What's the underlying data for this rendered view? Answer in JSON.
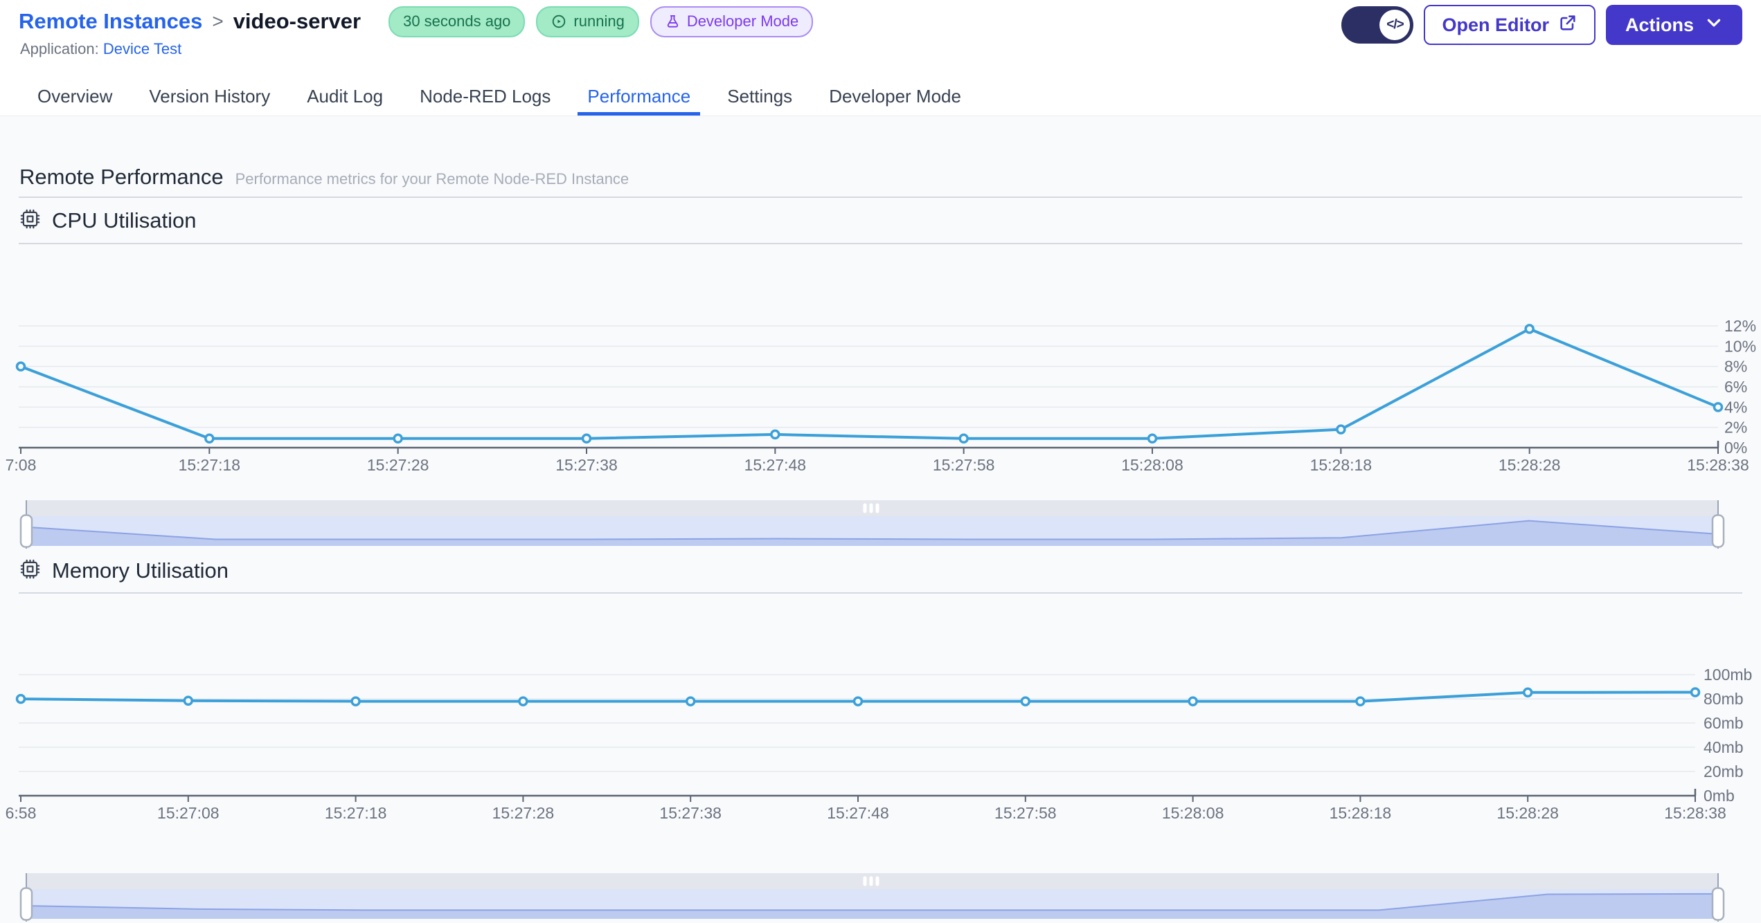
{
  "header": {
    "breadcrumb": {
      "parent": "Remote Instances",
      "separator": ">",
      "current": "video-server"
    },
    "badges": [
      {
        "label": "30 seconds ago",
        "style": "green"
      },
      {
        "label": "running",
        "style": "green",
        "icon": "play-circle-icon"
      },
      {
        "label": "Developer Mode",
        "style": "purple",
        "icon": "flask-icon"
      }
    ],
    "application_label": "Application:",
    "application_name": "Device Test",
    "developer_toggle_icon": "code-icon",
    "open_editor_label": "Open Editor",
    "actions_label": "Actions"
  },
  "tabs": [
    {
      "label": "Overview",
      "active": false
    },
    {
      "label": "Version History",
      "active": false
    },
    {
      "label": "Audit Log",
      "active": false
    },
    {
      "label": "Node-RED Logs",
      "active": false
    },
    {
      "label": "Performance",
      "active": true
    },
    {
      "label": "Settings",
      "active": false
    },
    {
      "label": "Developer Mode",
      "active": false
    }
  ],
  "page": {
    "title": "Remote Performance",
    "subtitle": "Performance metrics for your Remote Node-RED Instance"
  },
  "sections": [
    {
      "title": "CPU Utilisation",
      "icon": "cpu-chip-icon"
    },
    {
      "title": "Memory Utilisation",
      "icon": "cpu-chip-icon"
    }
  ],
  "colors": {
    "accent_indigo": "#4338CA",
    "toggle_navy": "#2B2F63",
    "link_blue": "#2563EB",
    "active_tab_blue": "#2563EB",
    "line_blue": "#3BA0D9",
    "grid": "#E4E9F0",
    "axis": "#5B6472",
    "tick_text": "#6B7280",
    "brush_strip": "#E4E6EE",
    "brush_band": "#DBE4F8",
    "brush_area_fill": "rgba(140,162,228,0.38)",
    "brush_area_line": "#8CA2E4",
    "handle_border": "#A8B0BF",
    "badge_green_bg": "#A3EAC7",
    "badge_green_border": "#7ADDB1",
    "badge_green_text": "#17724D",
    "badge_purple_bg": "#EFECFE",
    "badge_purple_border": "#A98BF5",
    "badge_purple_text": "#7C3AED"
  },
  "chart_data": [
    {
      "type": "line",
      "title": "CPU Utilisation",
      "x_ticks": [
        "7:08",
        "15:27:18",
        "15:27:28",
        "15:27:38",
        "15:27:48",
        "15:27:58",
        "15:28:08",
        "15:28:18",
        "15:28:28",
        "15:28:38"
      ],
      "series": [
        {
          "name": "cpu",
          "values": [
            8,
            0.9,
            0.9,
            0.9,
            1.3,
            0.9,
            0.9,
            1.8,
            11.7,
            4
          ]
        }
      ],
      "y_ticks": [
        "0%",
        "2%",
        "4%",
        "6%",
        "8%",
        "10%",
        "12%"
      ],
      "y_tick_values": [
        0,
        2,
        4,
        6,
        8,
        10,
        12
      ],
      "ylim": [
        0,
        12.8
      ],
      "xlabel": "",
      "ylabel": "",
      "grid": true,
      "legend": false
    },
    {
      "type": "line",
      "title": "Memory Utilisation",
      "x_ticks": [
        "6:58",
        "15:27:08",
        "15:27:18",
        "15:27:28",
        "15:27:38",
        "15:27:48",
        "15:27:58",
        "15:28:08",
        "15:28:18",
        "15:28:28",
        "15:28:38"
      ],
      "series": [
        {
          "name": "memory",
          "values": [
            80,
            78.5,
            78,
            78,
            78,
            78,
            78,
            78,
            78,
            85.3,
            85.5
          ]
        }
      ],
      "y_ticks": [
        "0mb",
        "20mb",
        "40mb",
        "60mb",
        "80mb",
        "100mb"
      ],
      "y_tick_values": [
        0,
        20,
        40,
        60,
        80,
        100
      ],
      "ylim": [
        0,
        114
      ],
      "xlabel": "",
      "ylabel": "",
      "grid": true,
      "legend": false
    }
  ]
}
